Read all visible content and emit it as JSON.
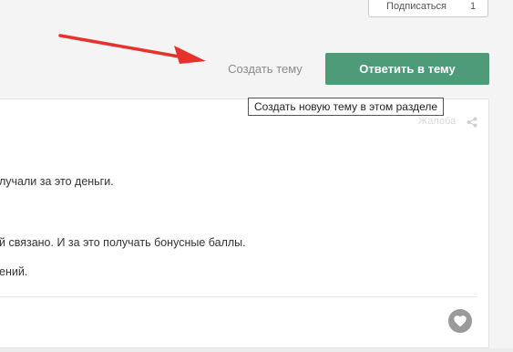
{
  "subscribe": {
    "label": "Подписаться",
    "count": "1"
  },
  "actions": {
    "create_topic": "Создать тему",
    "reply": "Ответить в тему",
    "tooltip": "Создать новую тему в этом разделе"
  },
  "post": {
    "meta": "Жалоба",
    "lines": [
      "лучали за это деньги.",
      "й связано. И за это получать бонусные баллы.",
      "ений."
    ]
  },
  "colors": {
    "accent": "#4e9b7a",
    "arrow": "#e5322d"
  },
  "icons": {
    "share": "share-icon",
    "like": "heart-icon",
    "pointer": "red-arrow"
  }
}
